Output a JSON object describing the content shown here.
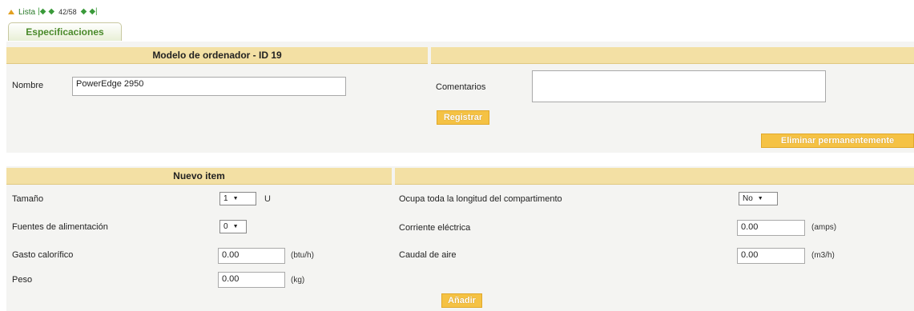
{
  "nav": {
    "list_label": "Lista",
    "counter": "42/58"
  },
  "tab": {
    "label": "Especificaciones"
  },
  "model": {
    "header": "Modelo de ordenador - ID 19",
    "name_label": "Nombre",
    "name_value": "PowerEdge 2950",
    "comments_label": "Comentarios",
    "comments_value": "",
    "register_button": "Registrar",
    "delete_button": "Eliminar permanentemente"
  },
  "new_item": {
    "header": "Nuevo item",
    "size_label": "Tamaño",
    "size_value": "1",
    "size_unit": "U",
    "psu_label": "Fuentes de alimentación",
    "psu_value": "0",
    "heat_label": "Gasto calorífico",
    "heat_value": "0.00",
    "heat_unit": "(btu/h)",
    "weight_label": "Peso",
    "weight_value": "0.00",
    "weight_unit": "(kg)",
    "full_length_label": "Ocupa toda la longitud del compartimento",
    "full_length_value": "No",
    "current_label": "Corriente eléctrica",
    "current_value": "0.00",
    "current_unit": "(amps)",
    "airflow_label": "Caudal de aire",
    "airflow_value": "0.00",
    "airflow_unit": "(m3/h)",
    "add_button": "Añadir"
  },
  "colors": {
    "header_bg": "#f3e0a4",
    "button_bg": "#f5c244",
    "panel_bg": "#f4f4f2",
    "tab_text": "#4a8a2a"
  }
}
